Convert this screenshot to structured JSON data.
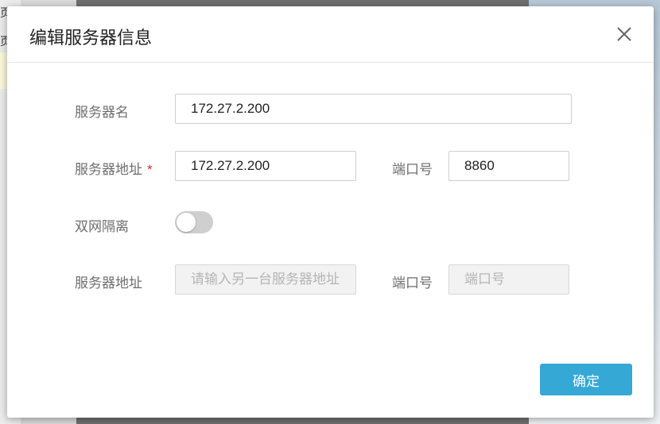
{
  "background": {
    "left_text_1": "页",
    "left_text_2": "页",
    "top_icons": [
      "qr-icon",
      "gift-icon",
      "close-icon"
    ]
  },
  "dialog": {
    "title": "编辑服务器信息",
    "fields": {
      "server_name": {
        "label": "服务器名",
        "value": "172.27.2.200"
      },
      "server_address": {
        "label": "服务器地址",
        "required_mark": "*",
        "value": "172.27.2.200"
      },
      "port": {
        "label": "端口号",
        "value": "8860"
      },
      "dual_network": {
        "label": "双网隔离",
        "enabled": false
      },
      "alt_server_address": {
        "label": "服务器地址",
        "placeholder": "请输入另一台服务器地址",
        "value": ""
      },
      "alt_port": {
        "label": "端口号",
        "placeholder": "端口号",
        "value": ""
      }
    },
    "confirm_label": "确定"
  },
  "colors": {
    "accent": "#35a8d6",
    "required": "#e0242b"
  }
}
